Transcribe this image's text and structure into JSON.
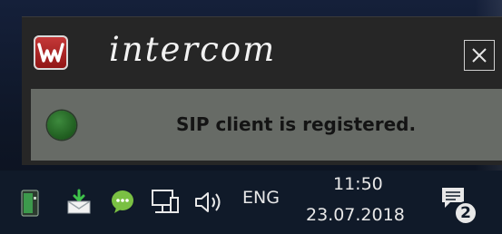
{
  "notification": {
    "app_name": "intercom",
    "logo_letter": "W",
    "status_text": "SIP client is registered.",
    "status_color": "#2f7a2f",
    "accent_color": "#a31d1d"
  },
  "taskbar": {
    "language": "ENG",
    "time": "11:50",
    "date": "23.07.2018",
    "notification_count": "2",
    "tray_icons": [
      "device-icon",
      "mail-download-icon",
      "chat-app-icon",
      "network-icon",
      "volume-icon"
    ]
  }
}
